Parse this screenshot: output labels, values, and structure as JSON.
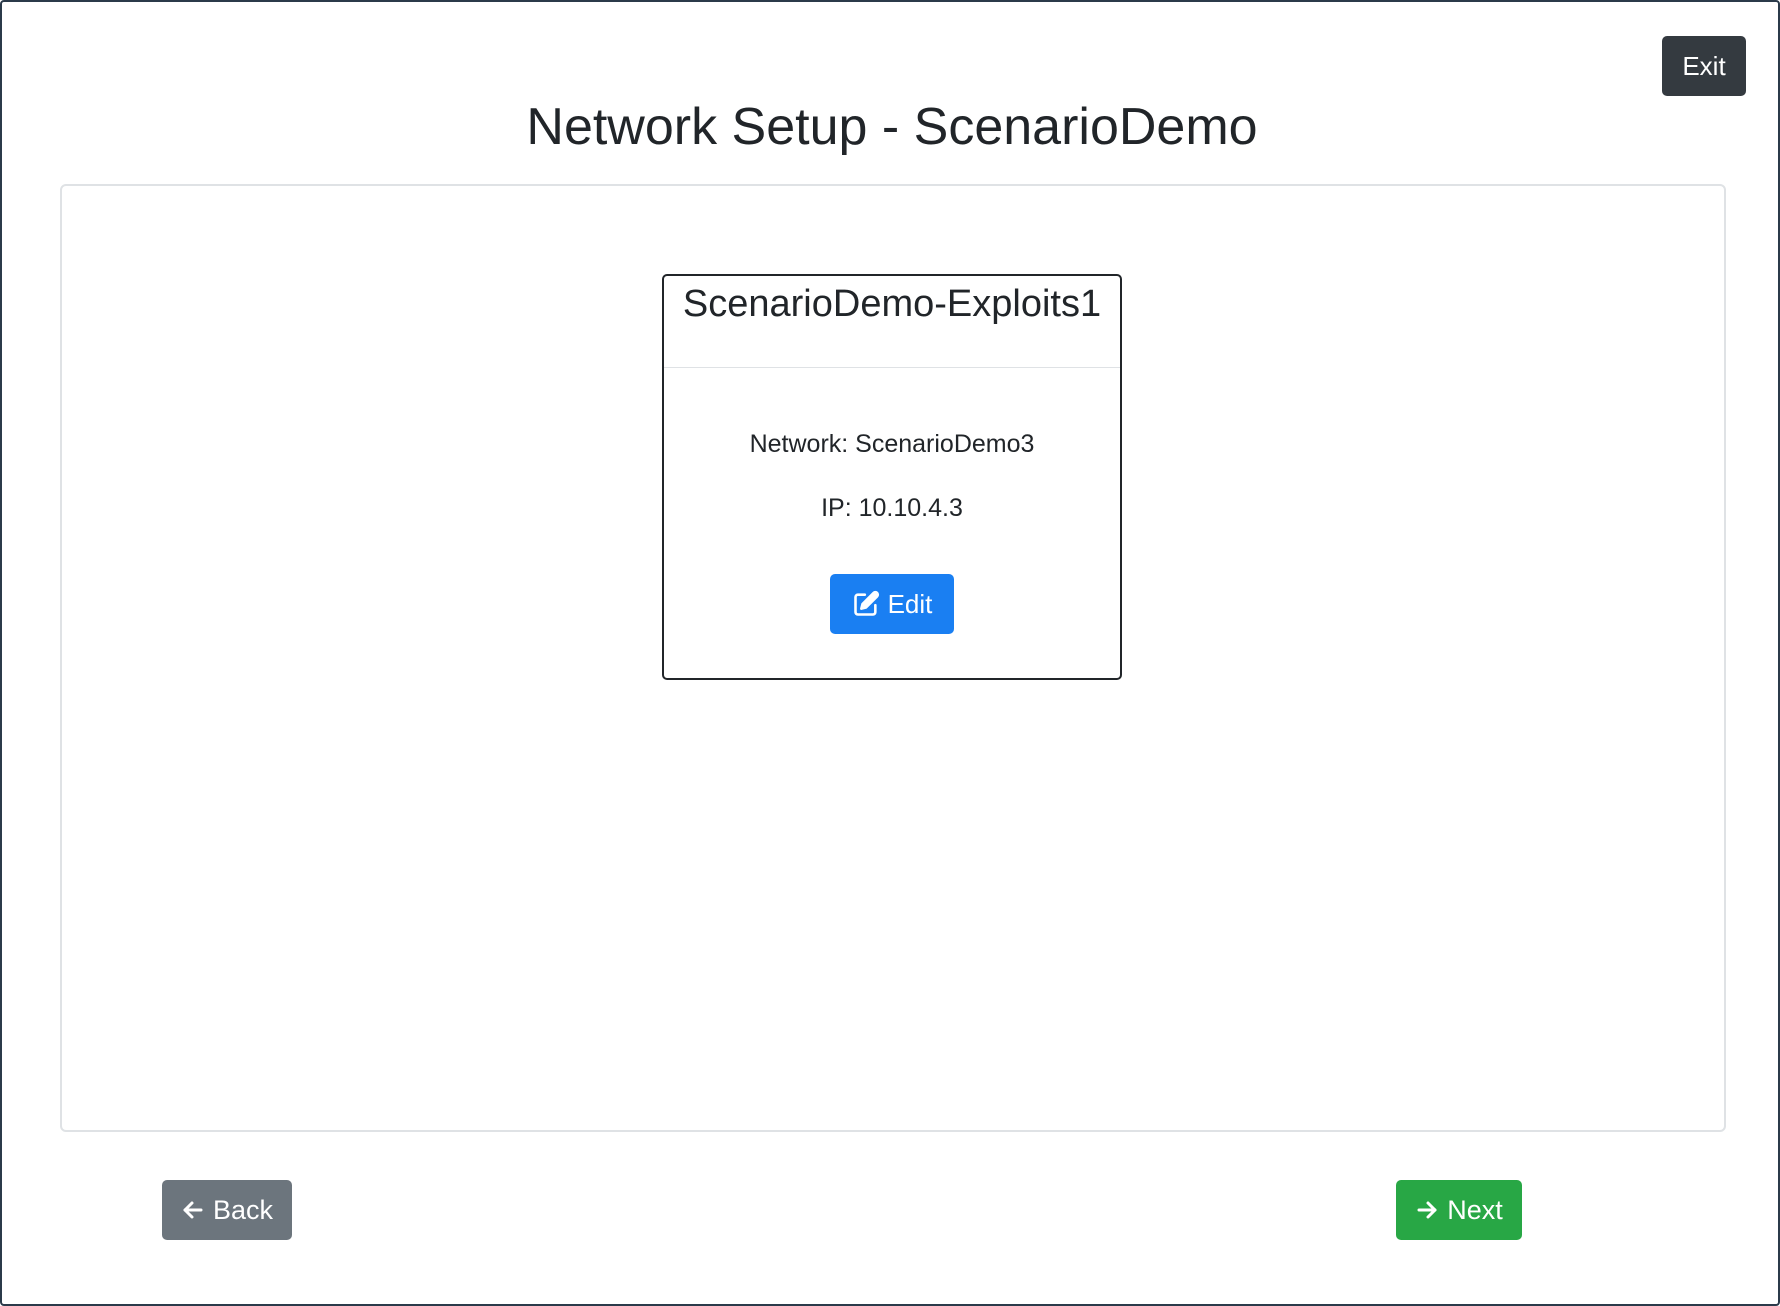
{
  "header": {
    "title": "Network Setup - ScenarioDemo",
    "exit_label": "Exit"
  },
  "node_card": {
    "name": "ScenarioDemo-Exploits1",
    "network": "Network: ScenarioDemo3",
    "ip": "IP: 10.10.4.3",
    "edit_label": "Edit",
    "edit_icon": "edit-icon"
  },
  "footer": {
    "back_label": "Back",
    "back_icon": "arrow-left-icon",
    "next_label": "Next",
    "next_icon": "arrow-right-icon"
  },
  "colors": {
    "exit_button": "#343a40",
    "edit_button": "#1a7ff2",
    "back_button": "#6c757d",
    "next_button": "#28a745"
  }
}
